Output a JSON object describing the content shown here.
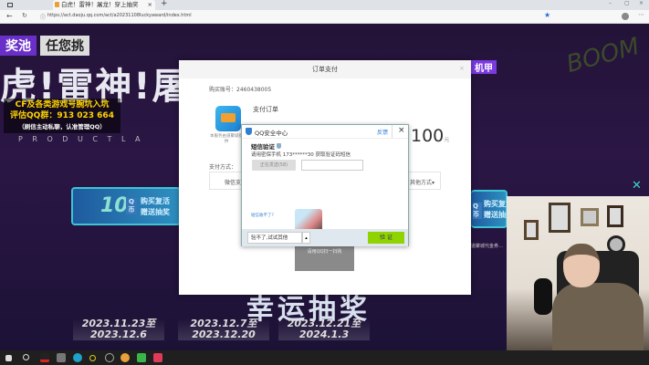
{
  "browser": {
    "tab_title": "白虎！雷神！屠龙！穿上抽奖",
    "url": "https://act.daoju.qq.com/act/a20231108luckyaward/index.html",
    "new_tab": "+",
    "tab_close": "×"
  },
  "banner": {
    "tag1": "奖池",
    "tag2": "任您挑",
    "headline": "虎!雷神!屠",
    "subtitle": "P R O D U C T   L A",
    "right_tag": "机甲",
    "graffiti": "BOOM"
  },
  "ad_overlay": {
    "line1": "CF及各类游戏号腕坑入坑",
    "line2": "评估QQ群：913 023 664",
    "line3": "（刷信主动私聊，认准管理QQ）"
  },
  "cards": [
    {
      "amount": "10",
      "unit": "Q币",
      "line1": "购买复活",
      "line2": "赠送抽奖"
    },
    {
      "amount": "10",
      "unit": "Q币",
      "line1": "购买复活",
      "line2": "赠送抽奖"
    }
  ],
  "side_note": "道聚城代金券…",
  "lottery_title": "幸运抽奖",
  "dates": [
    [
      "2023.11.23至",
      "2023.12.6"
    ],
    [
      "2023.12.7至",
      "2023.12.20"
    ],
    [
      "2023.12.21至",
      "2024.1.3"
    ]
  ],
  "order": {
    "title": "订单支付",
    "close": "×",
    "account_label": "购买账号：",
    "account": "2460438005",
    "pay_order": "支付订单",
    "provider": "本服务由道聚城提供",
    "price": "100",
    "currency": "元",
    "pay_method_label": "支付方式：",
    "method1": "微信支付",
    "method_other": "其他方式▾",
    "qr_text": "请用QQ扫一扫购"
  },
  "qq_dialog": {
    "title": "QQ安全中心",
    "feedback": "反馈",
    "close": "×",
    "heading": "短信验证",
    "instruction": "请用密保手机 173******30 获取验证码短信",
    "send_button": "正在发送(58)",
    "code_value": "",
    "cant_receive": "短信收不了?",
    "alt_button": "验不了,试试其他",
    "verify_button": "验 证"
  },
  "colors": {
    "accent_green": "#8fd400",
    "banner_purple": "#6a2fc9",
    "qq_blue": "#2f7fd0"
  }
}
